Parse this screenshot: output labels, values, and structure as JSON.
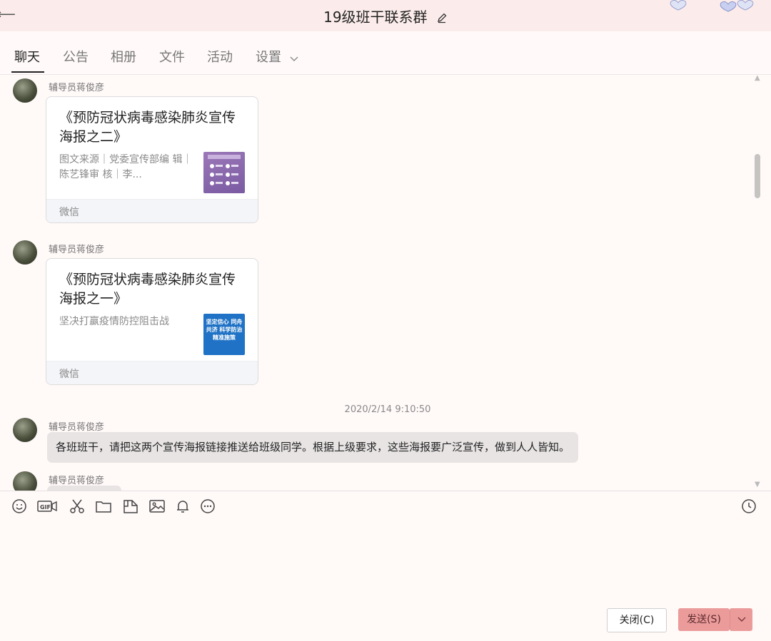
{
  "window": {
    "title": "19级班干联系群"
  },
  "tabs": [
    {
      "label": "聊天"
    },
    {
      "label": "公告"
    },
    {
      "label": "相册"
    },
    {
      "label": "文件"
    },
    {
      "label": "活动"
    },
    {
      "label": "设置"
    }
  ],
  "messages": {
    "card1": {
      "sender": "辅导员蒋俊彦",
      "title": "《预防冠状病毒感染肺炎宣传海报之二》",
      "desc": "图文来源｜党委宣传部编 辑｜陈艺锋审 核｜李...",
      "source": "微信"
    },
    "card2": {
      "sender": "辅导员蒋俊彦",
      "title": "《预防冠状病毒感染肺炎宣传海报之一》",
      "desc": "坚决打赢疫情防控阻击战",
      "thumb_text": "坚定信心 同舟共济 科学防治 精准施策",
      "source": "微信"
    },
    "timestamp": "2020/2/14 9:10:50",
    "text1": {
      "sender": "辅导员蒋俊彦",
      "text": "各班班干，请把这两个宣传海报链接推送给班级同学。根据上级要求，这些海报要广泛宣传，做到人人皆知。"
    },
    "partial": {
      "sender": "辅导员蒋俊彦"
    }
  },
  "toolbar": {
    "icons": [
      "emoji-icon",
      "gif-icon",
      "scissors-icon",
      "folder-icon",
      "sticker-icon",
      "image-icon",
      "bell-icon",
      "more-icon",
      "history-clock-icon"
    ]
  },
  "buttons": {
    "close_label": "关闭(C)",
    "send_label": "发送(S)"
  },
  "colors": {
    "titlebar_bg": "#fbeceb",
    "send_button": "#ec9b9b",
    "bubble_bg": "#e8e4e4"
  }
}
